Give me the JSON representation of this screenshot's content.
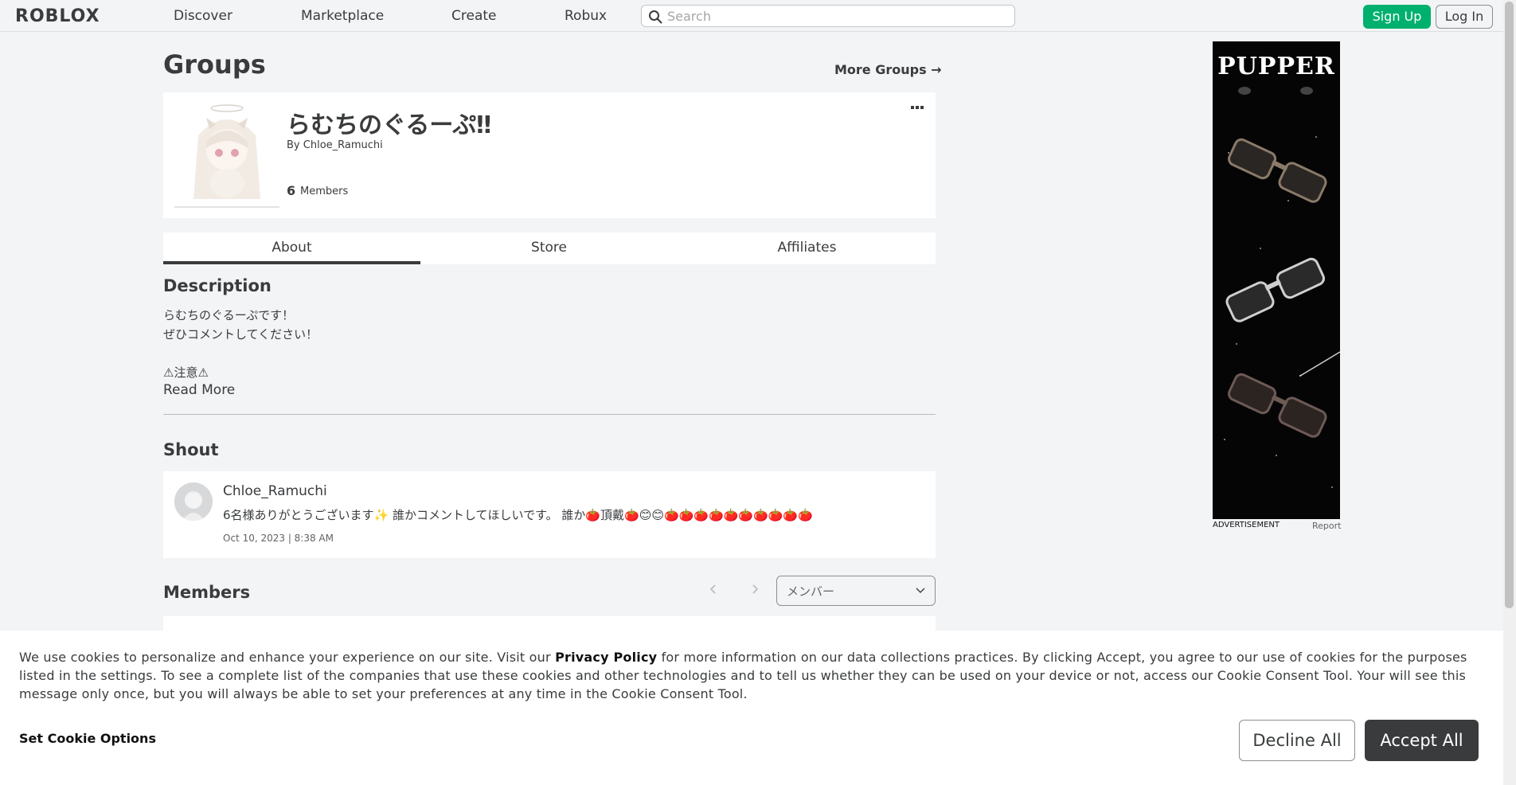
{
  "nav": {
    "logo": "ROBLOX",
    "links": [
      "Discover",
      "Marketplace",
      "Create",
      "Robux"
    ],
    "search_placeholder": "Search",
    "signup": "Sign Up",
    "login": "Log In"
  },
  "page": {
    "title": "Groups",
    "more_groups": "More Groups →"
  },
  "group": {
    "name": "らむちのぐるーぷ‼",
    "by": "By",
    "owner": "Chloe_Ramuchi",
    "member_count": "6",
    "member_label": "Members"
  },
  "tabs": [
    "About",
    "Store",
    "Affiliates"
  ],
  "description": {
    "heading": "Description",
    "lines": [
      "らむちのぐるーぷです！",
      "ぜひコメントしてください！",
      "⚠注意⚠"
    ],
    "read_more": "Read More"
  },
  "shout": {
    "heading": "Shout",
    "user": "Chloe_Ramuchi",
    "text": "6名様ありがとうございます✨ 誰かコメントしてほしいです。 誰か🍅頂戴🍅😊😊🍅🍅🍅🍅🍅🍅🍅🍅🍅🍅",
    "date": "Oct 10, 2023 | 8:38 AM"
  },
  "members": {
    "heading": "Members",
    "role_select": "メンバー"
  },
  "ad": {
    "brand": "PUPPER",
    "label": "ADVERTISEMENT",
    "report": "Report"
  },
  "cookie": {
    "text_before": "We use cookies to personalize and enhance your experience on our site. Visit our ",
    "privacy_link": "Privacy Policy",
    "text_after": " for more information on our data collections practices. By clicking Accept, you agree to our use of cookies for the purposes listed in the settings. To see a complete list of the companies that use these cookies and other technologies and to tell us whether they can be used on your device or not, access our Cookie Consent Tool. Your will see this message only once, but you will always be able to set your preferences at any time in the Cookie Consent Tool.",
    "set_options": "Set Cookie Options",
    "decline": "Decline All",
    "accept": "Accept All"
  }
}
